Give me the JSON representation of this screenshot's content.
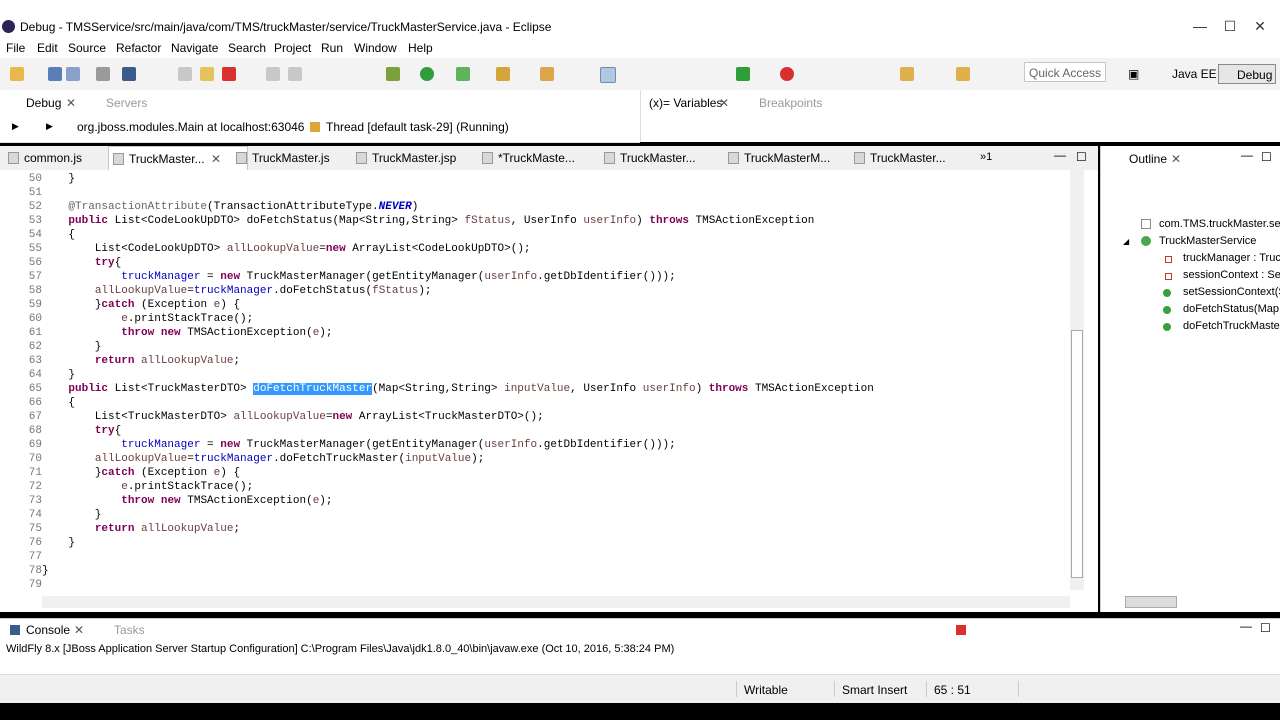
{
  "window": {
    "title": "Debug - TMSService/src/main/java/com/TMS/truckMaster/service/TruckMasterService.java - Eclipse"
  },
  "menu": [
    "File",
    "Edit",
    "Source",
    "Refactor",
    "Navigate",
    "Search",
    "Project",
    "Run",
    "Window",
    "Help"
  ],
  "toolbar": {
    "quick_access": "Quick Access"
  },
  "perspectives": {
    "java_ee": "Java EE",
    "debug": "Debug"
  },
  "debug_view": {
    "tabs": [
      "Debug",
      "Servers"
    ],
    "tree_line": "org.jboss.modules.Main at localhost:63046",
    "thread": "Thread [default task-29] (Running)"
  },
  "vars_view": {
    "tabs": [
      "(x)= Variables",
      "Breakpoints"
    ]
  },
  "editor_tabs": [
    "common.js",
    "TruckMaster...",
    "TruckMaster.js",
    "TruckMaster.jsp",
    "*TruckMaste...",
    "TruckMaster...",
    "TruckMasterM...",
    "TruckMaster..."
  ],
  "editor_tabs_overflow": "»1",
  "code": {
    "line_numbers": [
      "50",
      "51",
      "52",
      "53",
      "54",
      "55",
      "56",
      "57",
      "58",
      "59",
      "60",
      "61",
      "62",
      "63",
      "64",
      "65",
      "66",
      "67",
      "68",
      "69",
      "70",
      "71",
      "72",
      "73",
      "74",
      "75",
      "76",
      "77",
      "78",
      "79"
    ],
    "l50": "    }",
    "l52_ann": "@TransactionAttribute",
    "l52_mid": "(TransactionAttributeType.",
    "l52_const": "NEVER",
    "l52_end": ")",
    "kw_public": "public",
    "kw_throws": "throws",
    "kw_try": "try",
    "kw_catch": "catch",
    "kw_throw": "throw",
    "kw_new": "new",
    "kw_return": "return",
    "l53_a": " List<CodeLookUpDTO> doFetchStatus(Map<String,String> ",
    "l53_p1": "fStatus",
    "l53_b": ", UserInfo ",
    "l53_p2": "userInfo",
    "l53_c": ") ",
    "l53_d": " TMSActionException",
    "l54": "    {",
    "l55_a": "        List<CodeLookUpDTO> ",
    "l55_v": "allLookupValue",
    "l55_b": "=",
    "l55_c": " ArrayList<CodeLookUpDTO>();",
    "l56_b": "{",
    "l57_f": "truckManager",
    "l57_a": " = ",
    "l57_b": " TruckMasterManager(getEntityManager(",
    "l57_v": "userInfo",
    "l57_c": ".getDbIdentifier()));",
    "l58_v": "allLookupValue",
    "l58_a": "=",
    "l58_f": "truckManager",
    "l58_b": ".doFetchStatus(",
    "l58_p": "fStatus",
    "l58_c": ");",
    "l59_a": "}",
    "l59_b": " (Exception ",
    "l59_e": "e",
    "l59_c": ") {",
    "l60_e": "e",
    "l60_a": ".printStackTrace();",
    "l61_b": " TMSActionException(",
    "l61_e": "e",
    "l61_c": ");",
    "l62": "        }",
    "l63_v": "allLookupValue",
    "l63_c": ";",
    "l64": "    }",
    "l65_a": " List<TruckMasterDTO> ",
    "l65_sel": "doFetchTruckMaster",
    "l65_b": "(Map<String,String> ",
    "l65_p1": "inputValue",
    "l65_c": ", UserInfo ",
    "l65_p2": "userInfo",
    "l65_d": ") ",
    "l65_e": " TMSActionException",
    "l66": "    {",
    "l67_a": "        List<TruckMasterDTO> ",
    "l67_v": "allLookupValue",
    "l67_b": "=",
    "l67_c": " ArrayList<TruckMasterDTO>();",
    "l68_b": "{",
    "l69_f": "truckManager",
    "l69_a": " = ",
    "l69_b": " TruckMasterManager(getEntityManager(",
    "l69_v": "userInfo",
    "l69_c": ".getDbIdentifier()));",
    "l70_v": "allLookupValue",
    "l70_a": "=",
    "l70_f": "truckManager",
    "l70_b": ".doFetchTruckMaster(",
    "l70_p": "inputValue",
    "l70_c": ");",
    "l71_a": "}",
    "l71_b": " (Exception ",
    "l71_e": "e",
    "l71_c": ") {",
    "l72_e": "e",
    "l72_a": ".printStackTrace();",
    "l73_b": " TMSActionException(",
    "l73_e": "e",
    "l73_c": ");",
    "l74": "        }",
    "l75_v": "allLookupValue",
    "l75_c": ";",
    "l76": "    }",
    "l78": "}"
  },
  "outline": {
    "title": "Outline",
    "items": [
      "com.TMS.truckMaster.se",
      "TruckMasterService",
      "truckManager : Truc",
      "sessionContext : Ses",
      "setSessionContext(S",
      "doFetchStatus(Map",
      "doFetchTruckMaste"
    ]
  },
  "console": {
    "tabs": [
      "Console",
      "Tasks"
    ],
    "line": "WildFly  8.x [JBoss Application Server Startup Configuration] C:\\Program Files\\Java\\jdk1.8.0_40\\bin\\javaw.exe (Oct 10, 2016, 5:38:24 PM)"
  },
  "status": {
    "writable": "Writable",
    "insert": "Smart Insert",
    "position": "65 : 51"
  },
  "colors": {
    "keyword": "#7f0055",
    "field": "#0000c0",
    "selection": "#3399ff"
  }
}
